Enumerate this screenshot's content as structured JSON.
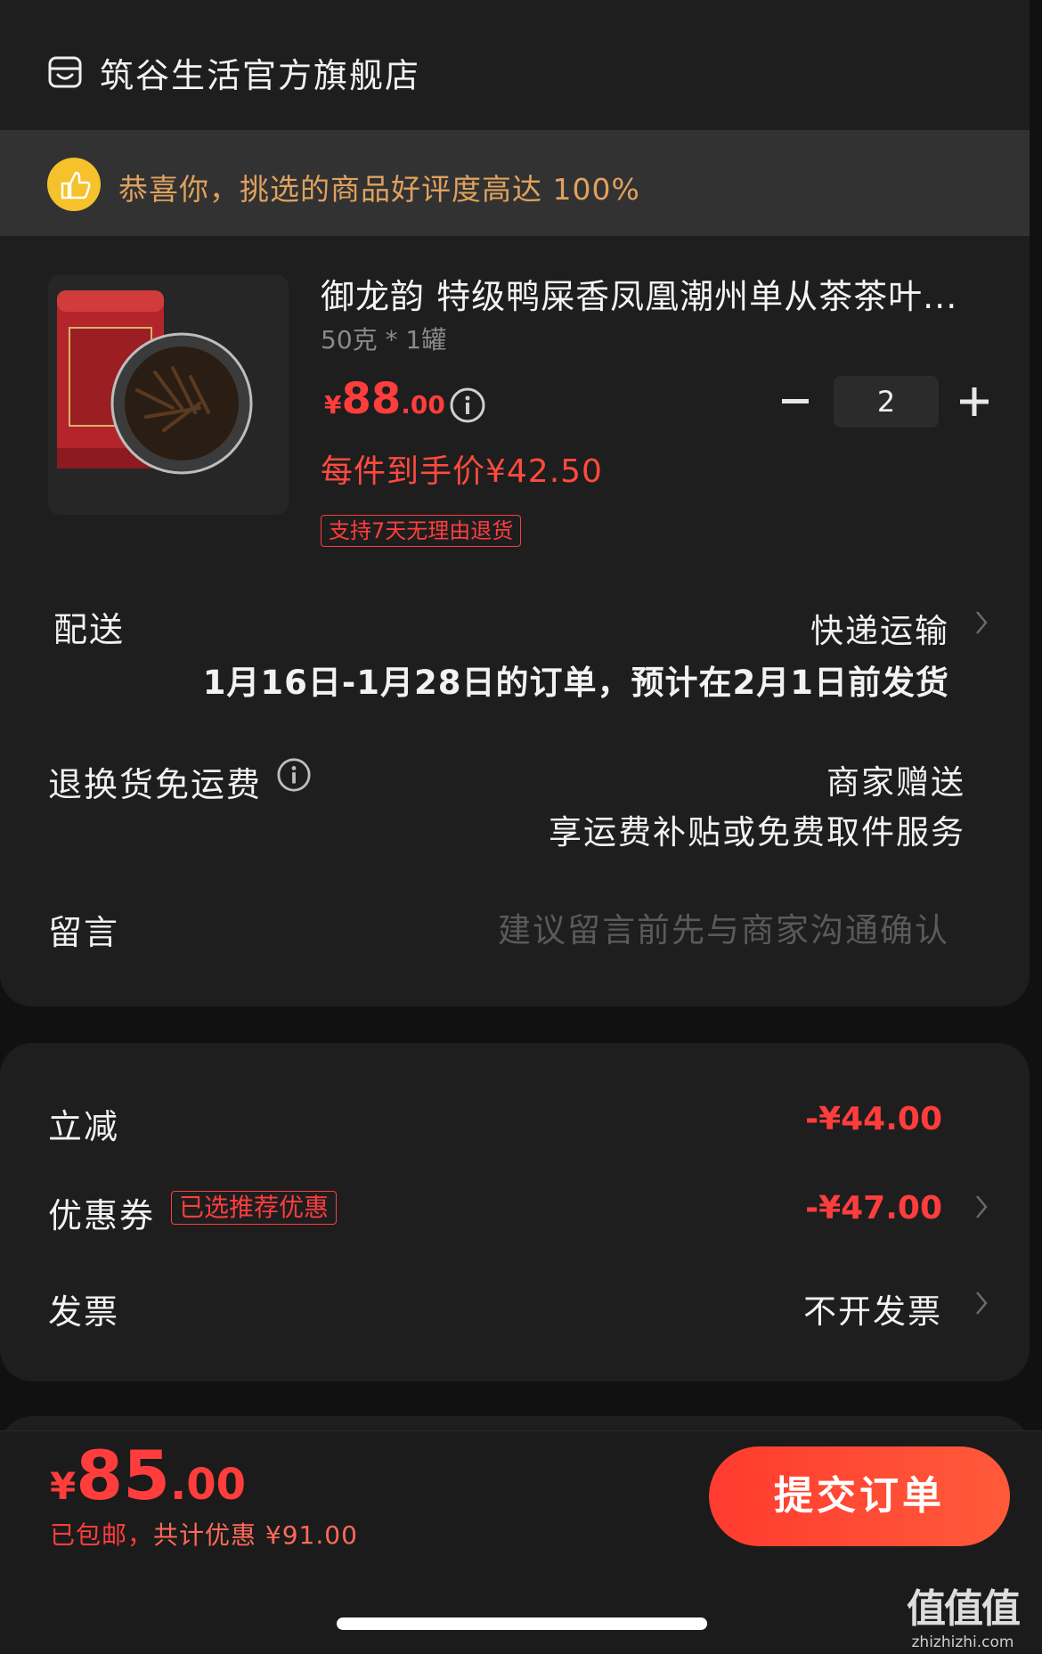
{
  "store": {
    "name": "筑谷生活官方旗舰店",
    "icon": "store-icon"
  },
  "banner": {
    "text": "恭喜你，挑选的商品好评度高达 100%",
    "icon": "thumbs-up-icon"
  },
  "product": {
    "title": "御龙韵 特级鸭屎香凤凰潮州单从茶茶叶...",
    "spec": "50克 * 1罐",
    "price_symbol": "¥",
    "price_int": "88",
    "price_dec": ".00",
    "unit_price": "每件到手价¥42.50",
    "return_badge": "支持7天无理由退货",
    "quantity": "2"
  },
  "delivery": {
    "label": "配送",
    "method": "快递运输",
    "note": "1月16日-1月28日的订单，预计在2月1日前发货"
  },
  "return_shipping": {
    "label": "退换货免运费",
    "value1": "商家赠送",
    "value2": "享运费补贴或免费取件服务"
  },
  "message": {
    "label": "留言",
    "placeholder": "建议留言前先与商家沟通确认"
  },
  "discounts": {
    "instant_label": "立减",
    "instant_value": "-¥44.00",
    "coupon_label": "优惠券",
    "coupon_badge": "已选推荐优惠",
    "coupon_value": "-¥47.00",
    "invoice_label": "发票",
    "invoice_value": "不开发票"
  },
  "footer": {
    "total_symbol": "¥",
    "total_int": "85",
    "total_dec": ".00",
    "sub_note": "已包邮，",
    "sub_saving": "共计优惠 ¥91.00",
    "submit_label": "提交订单"
  },
  "watermark": {
    "line1": "值值值",
    "line2": "zhizhizhi.com"
  },
  "colors": {
    "accent": "#ff3d3d",
    "banner_text": "#e0a15e",
    "background": "#111111",
    "card": "#1e1e1e"
  }
}
